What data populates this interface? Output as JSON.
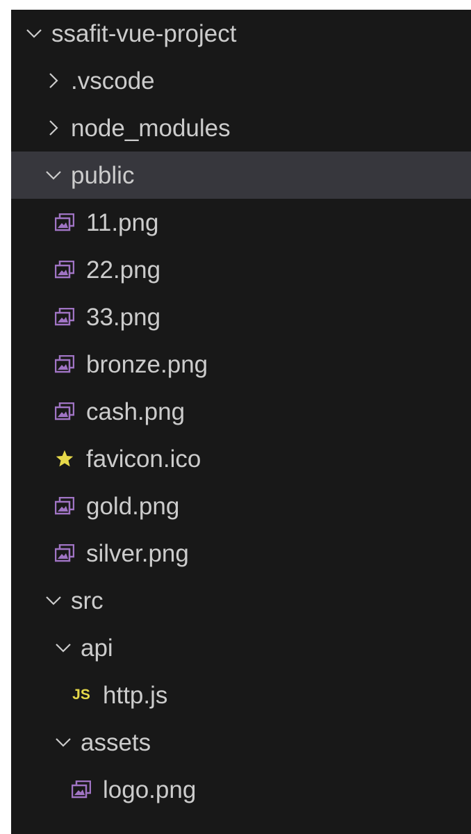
{
  "explorer": {
    "root": {
      "label": "ssafit-vue-project",
      "expanded": true
    },
    "items": [
      {
        "type": "folder",
        "label": ".vscode",
        "expanded": false,
        "icon": "chevron-right-icon"
      },
      {
        "type": "folder",
        "label": "node_modules",
        "expanded": false,
        "icon": "chevron-right-icon"
      },
      {
        "type": "folder",
        "label": "public",
        "expanded": true,
        "selected": true,
        "icon": "chevron-down-icon"
      },
      {
        "type": "file",
        "label": "11.png",
        "icon": "image-file-icon"
      },
      {
        "type": "file",
        "label": "22.png",
        "icon": "image-file-icon"
      },
      {
        "type": "file",
        "label": "33.png",
        "icon": "image-file-icon"
      },
      {
        "type": "file",
        "label": "bronze.png",
        "icon": "image-file-icon"
      },
      {
        "type": "file",
        "label": "cash.png",
        "icon": "image-file-icon"
      },
      {
        "type": "file",
        "label": "favicon.ico",
        "icon": "star-icon"
      },
      {
        "type": "file",
        "label": "gold.png",
        "icon": "image-file-icon"
      },
      {
        "type": "file",
        "label": "silver.png",
        "icon": "image-file-icon"
      },
      {
        "type": "folder",
        "label": "src",
        "expanded": true,
        "icon": "chevron-down-icon"
      },
      {
        "type": "folder",
        "label": "api",
        "expanded": true,
        "icon": "chevron-down-icon"
      },
      {
        "type": "file",
        "label": "http.js",
        "icon": "js-file-icon",
        "badge": "JS"
      },
      {
        "type": "folder",
        "label": "assets",
        "expanded": true,
        "icon": "chevron-down-icon"
      },
      {
        "type": "file",
        "label": "logo.png",
        "icon": "image-file-icon"
      }
    ]
  },
  "colors": {
    "background": "#181818",
    "selected_row": "#37373d",
    "text": "#cccccc",
    "image_icon": "#a074c4",
    "favicon_star": "#e6d94a",
    "js_badge": "#e6d94a"
  }
}
